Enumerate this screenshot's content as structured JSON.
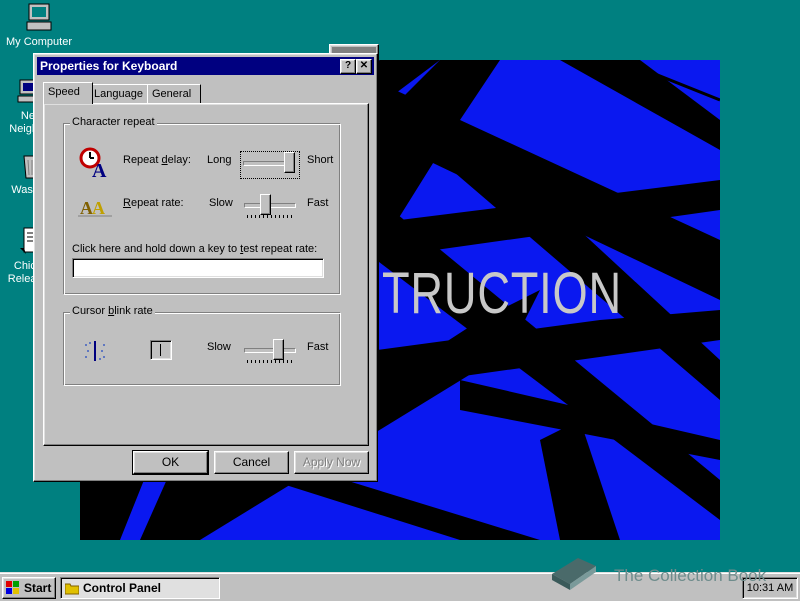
{
  "desktop": {
    "icons": [
      {
        "label": "My Computer",
        "icon": "computer-icon"
      },
      {
        "label": "Net\nNeigh",
        "icon": "network-icon"
      },
      {
        "label": "Waste",
        "icon": "recycle-bin-icon"
      },
      {
        "label": "Chica\nReleas",
        "icon": "document-icon"
      }
    ],
    "wallpaper_text": "TRUCTION"
  },
  "dialog": {
    "title": "Properties for Keyboard",
    "help_button": "?",
    "close_button": "✕",
    "tabs": [
      {
        "label": "Speed",
        "active": true
      },
      {
        "label": "Language",
        "active": false
      },
      {
        "label": "General",
        "active": false
      }
    ],
    "character_repeat": {
      "group_title": "Character repeat",
      "repeat_delay": {
        "label_pre": "Repeat ",
        "label_ul": "d",
        "label_post": "elay:",
        "min_label": "Long",
        "max_label": "Short",
        "level": 1.0
      },
      "repeat_rate": {
        "label_pre": "",
        "label_ul": "R",
        "label_post": "epeat rate:",
        "min_label": "Slow",
        "max_label": "Fast",
        "level": 0.4
      },
      "test_prompt_pre": "Click here and hold down a key to ",
      "test_prompt_ul": "t",
      "test_prompt_post": "est repeat rate:",
      "test_value": ""
    },
    "cursor_blink": {
      "group_title_pre": "Cursor ",
      "group_title_ul": "b",
      "group_title_post": "link rate",
      "min_label": "Slow",
      "max_label": "Fast",
      "level": 0.7
    },
    "buttons": {
      "ok": "OK",
      "cancel": "Cancel",
      "apply": "Apply Now"
    }
  },
  "taskbar": {
    "start_label": "Start",
    "task_label": "Control Panel",
    "clock": "10:31 AM"
  },
  "watermark": "The Collection Book",
  "colors": {
    "desktop": "#008080",
    "titlebar": "#000080",
    "face": "#c0c0c0",
    "wallpaper": "#0a18f0"
  }
}
